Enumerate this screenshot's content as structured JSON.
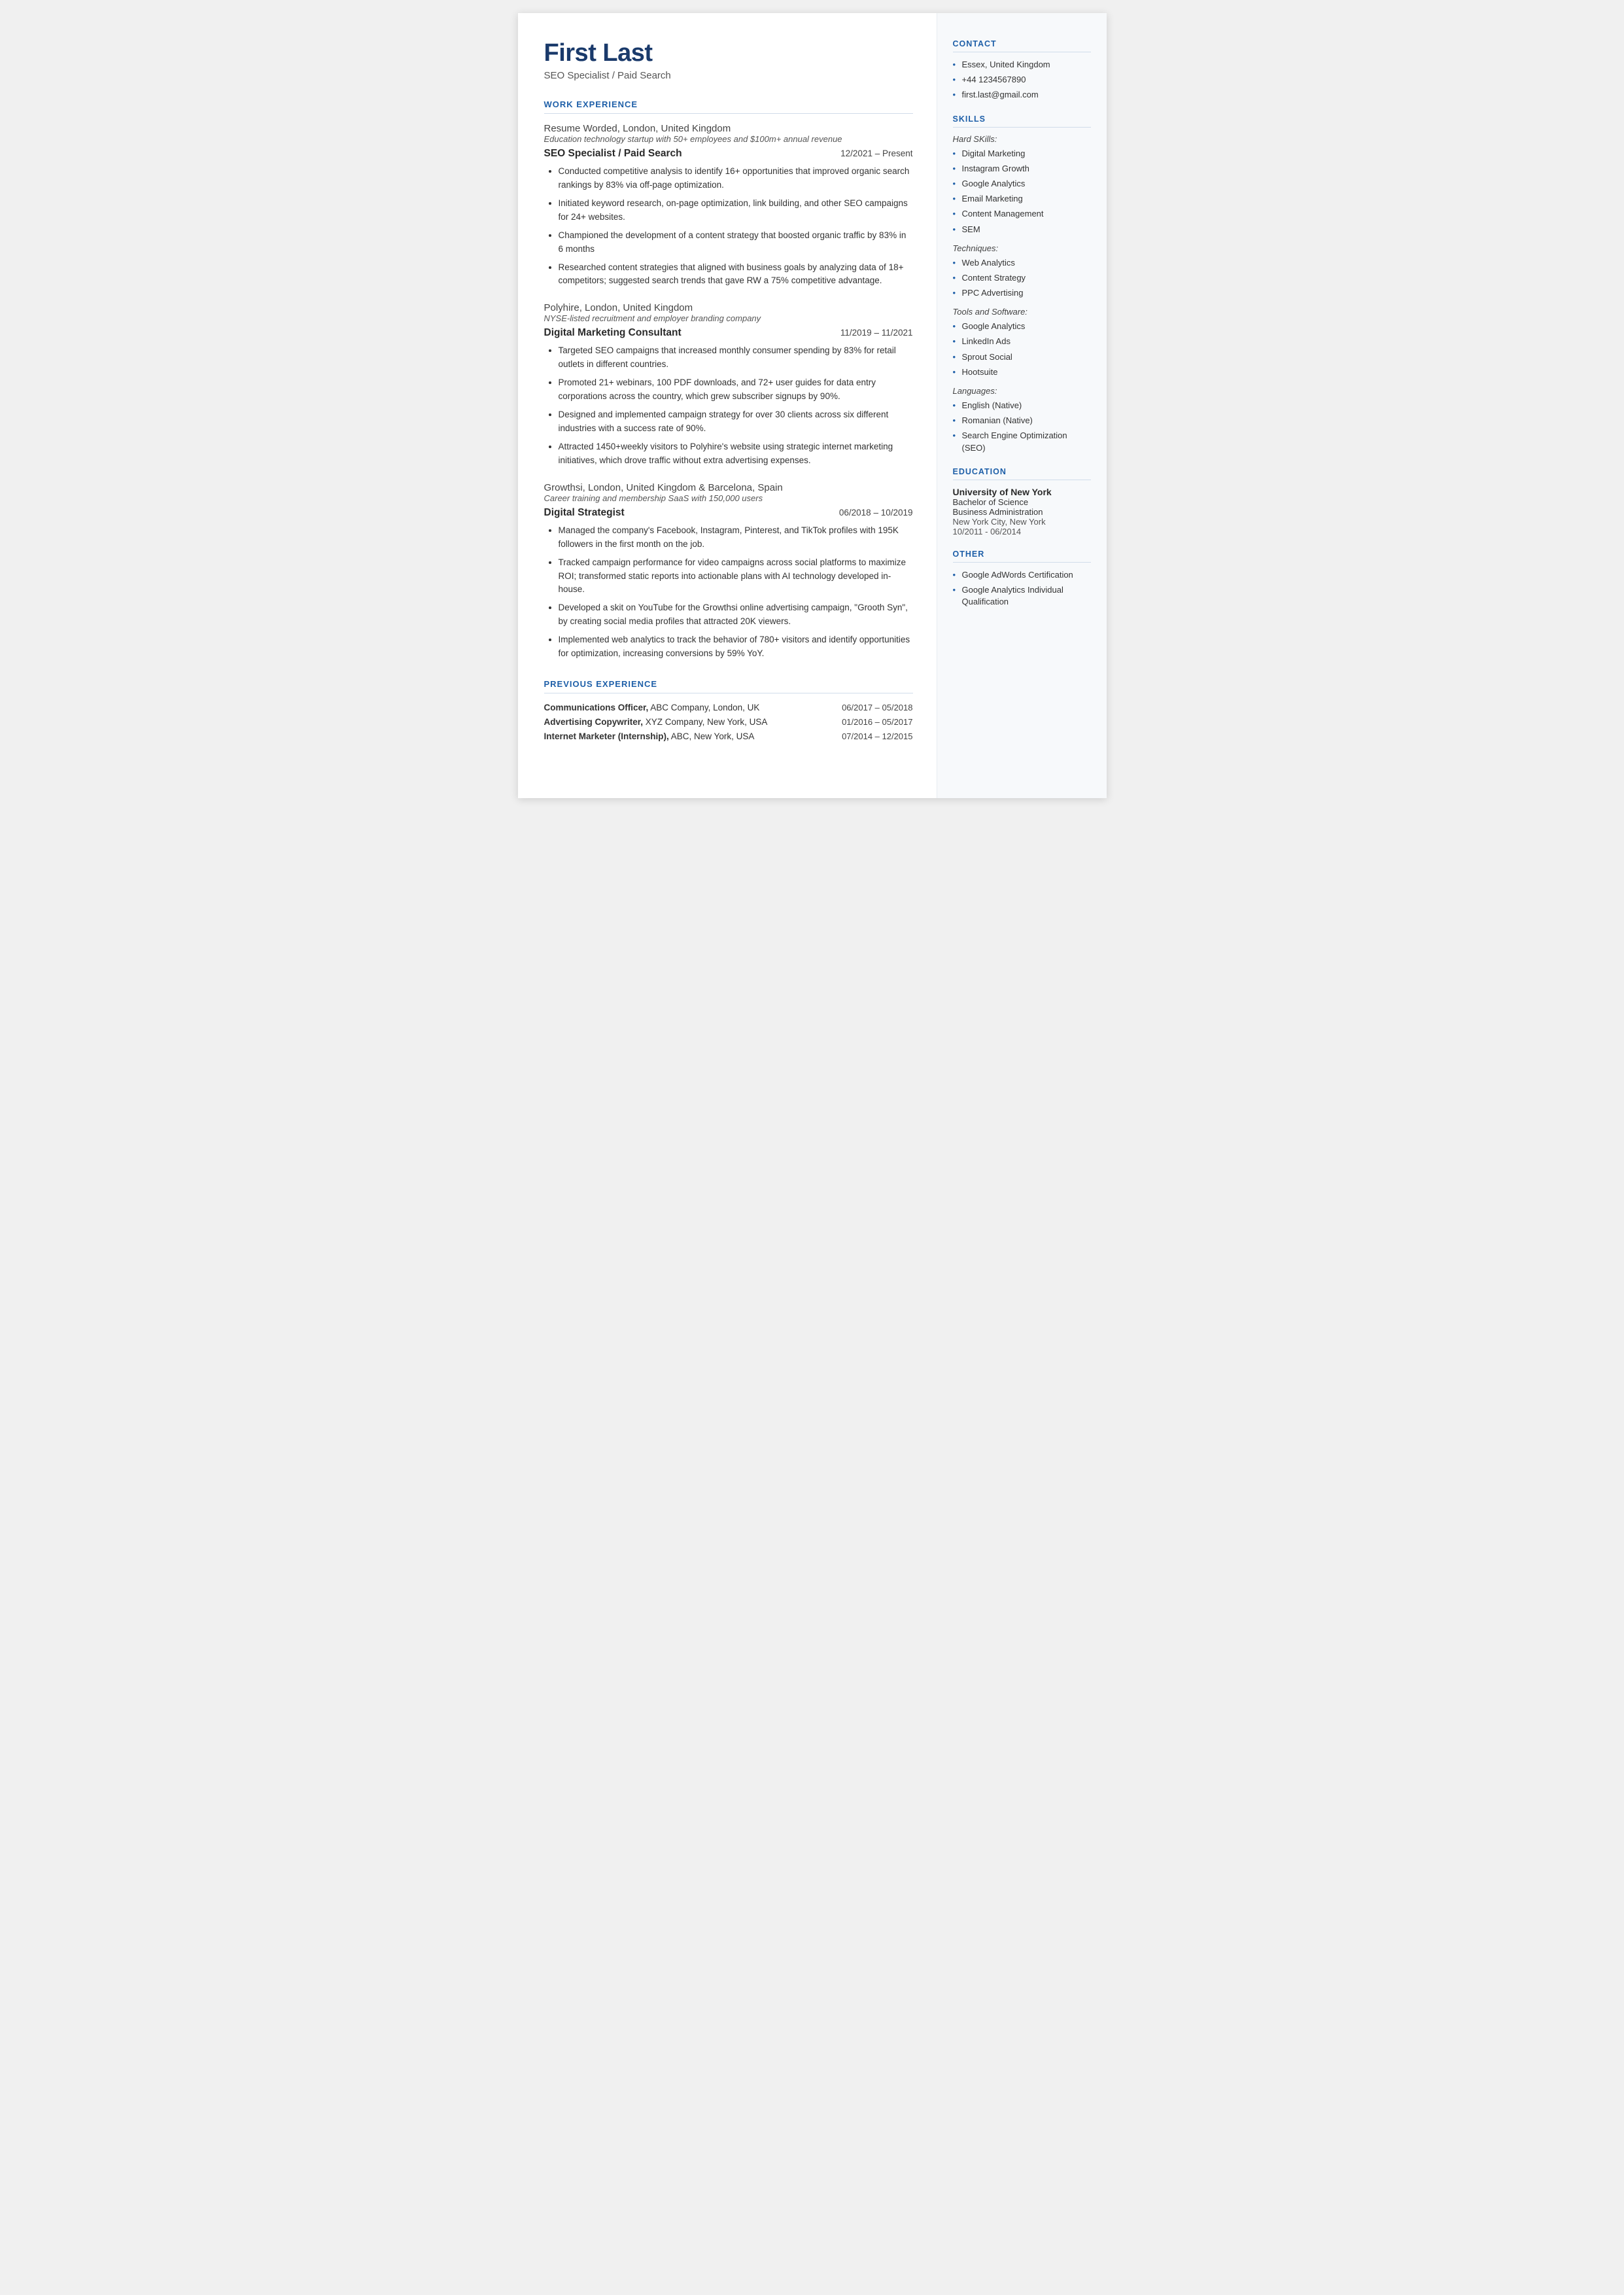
{
  "header": {
    "name": "First Last",
    "subtitle": "SEO Specialist / Paid Search"
  },
  "sections": {
    "work_experience_label": "WORK EXPERIENCE",
    "previous_experience_label": "PREVIOUS EXPERIENCE"
  },
  "work_experience": [
    {
      "employer": "Resume Worded,",
      "employer_rest": " London, United Kingdom",
      "tagline": "Education technology startup with 50+ employees and $100m+ annual revenue",
      "role": "SEO Specialist / Paid Search",
      "dates": "12/2021 – Present",
      "bullets": [
        "Conducted competitive analysis to identify 16+ opportunities that improved organic search rankings by 83% via off-page optimization.",
        "Initiated keyword research, on-page optimization, link building, and other SEO campaigns for 24+ websites.",
        "Championed the development of a content strategy that boosted organic traffic by 83% in 6 months",
        "Researched content strategies that aligned with business goals by analyzing data of 18+ competitors; suggested search trends that gave RW a 75% competitive advantage."
      ]
    },
    {
      "employer": "Polyhire,",
      "employer_rest": " London, United Kingdom",
      "tagline": "NYSE-listed recruitment and employer branding company",
      "role": "Digital Marketing Consultant",
      "dates": "11/2019 – 11/2021",
      "bullets": [
        "Targeted SEO campaigns that increased monthly consumer spending by 83% for retail outlets in different countries.",
        "Promoted 21+ webinars, 100 PDF downloads, and 72+ user guides for data entry corporations across the country, which grew subscriber signups by 90%.",
        "Designed and implemented campaign strategy for over 30 clients across six different industries with a success rate of 90%.",
        "Attracted 1450+weekly visitors to Polyhire's website using strategic internet marketing initiatives, which drove traffic without extra advertising expenses."
      ]
    },
    {
      "employer": "Growthsi,",
      "employer_rest": " London, United Kingdom & Barcelona, Spain",
      "tagline": "Career training and membership SaaS with 150,000 users",
      "role": "Digital Strategist",
      "dates": "06/2018 – 10/2019",
      "bullets": [
        "Managed the company's Facebook, Instagram, Pinterest, and TikTok profiles with 195K followers in the first month on the job.",
        "Tracked campaign performance for video campaigns across social platforms to maximize ROI; transformed static reports into actionable plans with AI technology developed in-house.",
        "Developed a skit on YouTube for the Growthsi online advertising campaign, \"Grooth Syn\", by creating social media profiles that attracted 20K viewers.",
        "Implemented web analytics to track the behavior of 780+ visitors and identify opportunities for optimization, increasing conversions by 59% YoY."
      ]
    }
  ],
  "previous_experience": [
    {
      "title": "Communications Officer,",
      "company": " ABC Company, London, UK",
      "dates": "06/2017 – 05/2018"
    },
    {
      "title": "Advertising Copywriter,",
      "company": " XYZ Company, New York, USA",
      "dates": "01/2016 – 05/2017"
    },
    {
      "title": "Internet Marketer (Internship),",
      "company": " ABC, New York, USA",
      "dates": "07/2014 – 12/2015"
    }
  ],
  "sidebar": {
    "contact_label": "CONTACT",
    "contact": [
      "Essex, United Kingdom",
      "+44 1234567890",
      "first.last@gmail.com"
    ],
    "skills_label": "SKILLS",
    "hard_skills_label": "Hard SKills:",
    "hard_skills": [
      "Digital Marketing",
      "Instagram Growth",
      "Google Analytics",
      "Email Marketing",
      "Content Management",
      "SEM"
    ],
    "techniques_label": "Techniques:",
    "techniques": [
      "Web Analytics",
      "Content Strategy",
      "PPC Advertising"
    ],
    "tools_label": "Tools and Software:",
    "tools": [
      "Google Analytics",
      "LinkedIn Ads",
      "Sprout Social",
      "Hootsuite"
    ],
    "languages_label": "Languages:",
    "languages": [
      "English (Native)",
      "Romanian (Native)",
      "Search Engine Optimization (SEO)"
    ],
    "education_label": "EDUCATION",
    "education": {
      "institution": "University of New York",
      "degree": "Bachelor of Science",
      "field": "Business Administration",
      "location": "New York City, New York",
      "dates": "10/2011 - 06/2014"
    },
    "other_label": "OTHER",
    "other": [
      "Google AdWords Certification",
      "Google Analytics Individual Qualification"
    ]
  }
}
